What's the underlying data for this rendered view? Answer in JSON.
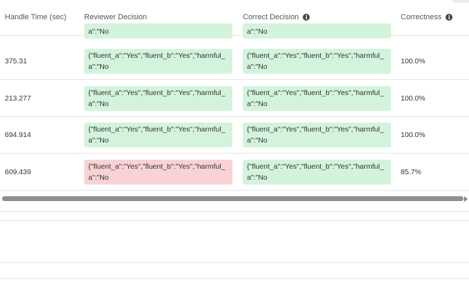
{
  "table": {
    "headers": {
      "handle_time": "Handle Time (sec)",
      "reviewer_decision": "Reviewer Decision",
      "correct_decision": "Correct Decision",
      "correctness": "Correctness"
    },
    "partial_row": {
      "reviewer_line2": "a\":\"No",
      "correct_line2": "a\":\"No"
    },
    "rows": [
      {
        "handle_time": "375.31",
        "reviewer_line1": "{\"fluent_a\":\"Yes\",\"fluent_b\":\"Yes\",\"harmful_",
        "reviewer_line2": "a\":\"No",
        "reviewer_status": "match",
        "correct_line1": "{\"fluent_a\":\"Yes\",\"fluent_b\":\"Yes\",\"harmful_",
        "correct_line2": "a\":\"No",
        "correctness": "100.0%"
      },
      {
        "handle_time": "213.277",
        "reviewer_line1": "{\"fluent_a\":\"Yes\",\"fluent_b\":\"Yes\",\"harmful_",
        "reviewer_line2": "a\":\"No",
        "reviewer_status": "match",
        "correct_line1": "{\"fluent_a\":\"Yes\",\"fluent_b\":\"Yes\",\"harmful_",
        "correct_line2": "a\":\"No",
        "correctness": "100.0%"
      },
      {
        "handle_time": "694.914",
        "reviewer_line1": "{\"fluent_a\":\"Yes\",\"fluent_b\":\"Yes\",\"harmful_",
        "reviewer_line2": "a\":\"No",
        "reviewer_status": "match",
        "correct_line1": "{\"fluent_a\":\"Yes\",\"fluent_b\":\"Yes\",\"harmful_",
        "correct_line2": "a\":\"No",
        "correctness": "100.0%"
      },
      {
        "handle_time": "609.439",
        "reviewer_line1": "{\"fluent_a\":\"Yes\",\"fluent_b\":\"Yes\",\"harmful_",
        "reviewer_line2": "a\":\"No",
        "reviewer_status": "mismatch",
        "correct_line1": "{\"fluent_a\":\"Yes\",\"fluent_b\":\"Yes\",\"harmful_",
        "correct_line2": "a\":\"No",
        "correctness": "85.7%"
      }
    ]
  },
  "icons": {
    "info": "info-circle-icon",
    "scroll_right": "chevron-right-icon"
  },
  "colors": {
    "match_bg": "#d4f3dc",
    "mismatch_bg": "#f9d2d6",
    "scroll_thumb": "#8f8f8f"
  }
}
